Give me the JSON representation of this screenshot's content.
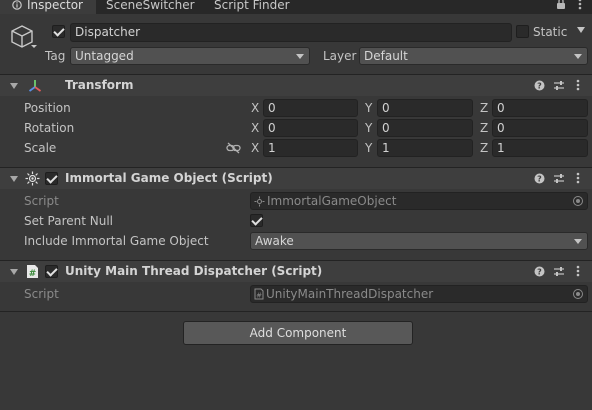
{
  "tabs": [
    {
      "label": "Inspector",
      "active": true
    },
    {
      "label": "SceneSwitcher",
      "active": false
    },
    {
      "label": "Script Finder",
      "active": false
    }
  ],
  "object": {
    "name": "Dispatcher",
    "active": true,
    "static_label": "Static",
    "static_checked": false,
    "tag_label": "Tag",
    "tag_value": "Untagged",
    "layer_label": "Layer",
    "layer_value": "Default"
  },
  "transform": {
    "title": "Transform",
    "rows": [
      {
        "label": "Position",
        "x": "0",
        "y": "0",
        "z": "0"
      },
      {
        "label": "Rotation",
        "x": "0",
        "y": "0",
        "z": "0"
      },
      {
        "label": "Scale",
        "x": "1",
        "y": "1",
        "z": "1"
      }
    ],
    "axis_labels": {
      "x": "X",
      "y": "Y",
      "z": "Z"
    }
  },
  "immortal": {
    "title": "Immortal Game Object (Script)",
    "enabled": true,
    "script_label": "Script",
    "script_value": "ImmortalGameObject",
    "set_parent_null_label": "Set Parent Null",
    "set_parent_null": true,
    "include_label": "Include Immortal Game Object",
    "include_value": "Awake"
  },
  "dispatcher": {
    "title": "Unity Main Thread Dispatcher (Script)",
    "enabled": true,
    "script_label": "Script",
    "script_value": "UnityMainThreadDispatcher"
  },
  "add_component_label": "Add Component",
  "colors": {
    "background": "#383838",
    "tabbar": "#282828",
    "field": "#2a2a2a",
    "header": "#3e3e3e"
  }
}
